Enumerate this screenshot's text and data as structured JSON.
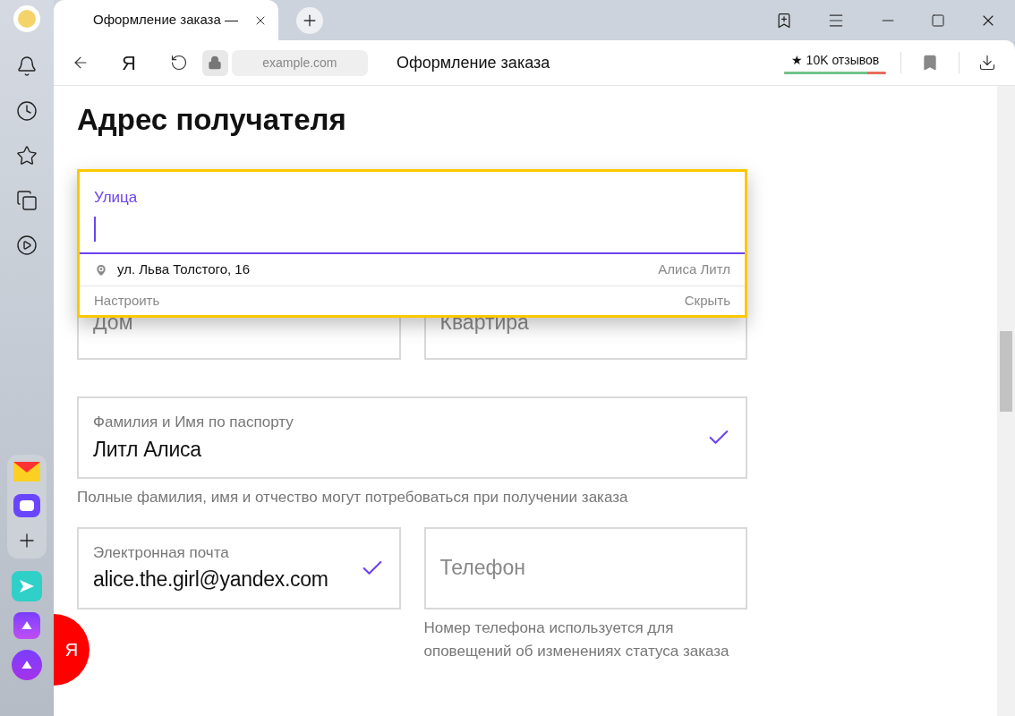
{
  "tabs": [
    {
      "title": "Оформление заказа —",
      "selected": true
    }
  ],
  "toolbar": {
    "logo": "Я",
    "address": "example.com",
    "page_title": "Оформление заказа",
    "rating": "★ 10K отзывов",
    "rating_bar": {
      "level": 0.82
    }
  },
  "side_badge": "Я",
  "form": {
    "heading": "Адрес получателя",
    "street": {
      "label": "Улица",
      "focused": true,
      "suggestion": {
        "address": "ул. Льва Толстого, 16",
        "name": "Алиса Литл"
      },
      "actions": [
        "Настроить",
        "Скрыть"
      ]
    },
    "house": {
      "placeholder": "Дом"
    },
    "apartment": {
      "placeholder": "Квартира"
    },
    "full_name": {
      "label": "Фамилия и Имя по паспорту",
      "value": "Литл Алиса",
      "valid": true
    },
    "full_name_hint": "Полные фамилия, имя и отчество могут потребоваться при получении заказа",
    "email": {
      "label": "Электронная почта",
      "value": "alice.the.girl@yandex.com",
      "valid": true
    },
    "phone": {
      "placeholder": "Телефон"
    },
    "phone_hint": "Номер телефона используется для оповещений об изменениях статуса заказа"
  }
}
